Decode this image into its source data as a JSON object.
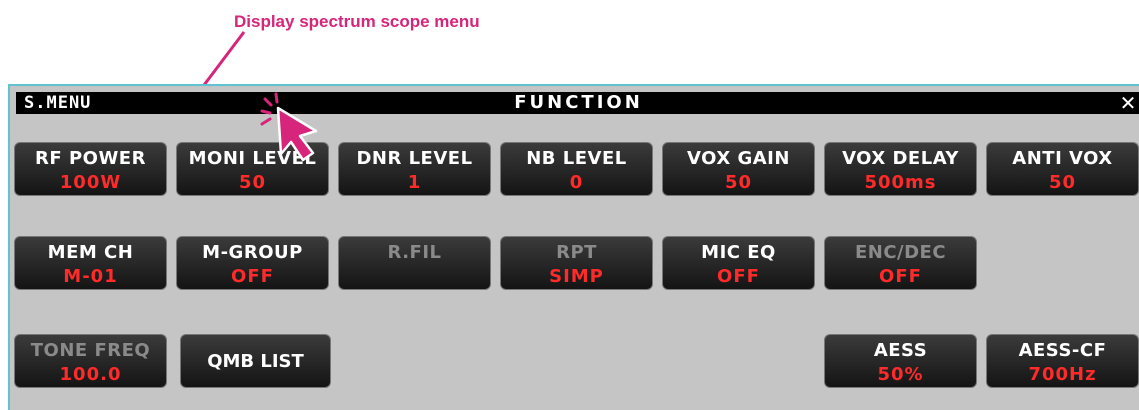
{
  "annotation": "Display spectrum scope menu",
  "titlebar": {
    "menu": "S.MENU",
    "title": "FUNCTION",
    "close": "✕"
  },
  "buttons": {
    "row1": [
      {
        "label": "RF POWER",
        "value": "100W"
      },
      {
        "label": "MONI LEVEL",
        "value": "50"
      },
      {
        "label": "DNR LEVEL",
        "value": "1"
      },
      {
        "label": "NB LEVEL",
        "value": "0"
      },
      {
        "label": "VOX GAIN",
        "value": "50"
      },
      {
        "label": "VOX DELAY",
        "value": "500ms"
      },
      {
        "label": "ANTI VOX",
        "value": "50"
      }
    ],
    "row2": [
      {
        "label": "MEM CH",
        "value": "M-01"
      },
      {
        "label": "M-GROUP",
        "value": "OFF"
      },
      {
        "label": "R.FIL"
      },
      {
        "label": "RPT",
        "value": "SIMP"
      },
      {
        "label": "MIC EQ",
        "value": "OFF"
      },
      {
        "label": "ENC/DEC",
        "value": "OFF"
      }
    ],
    "row3": [
      {
        "label": "TONE FREQ",
        "value": "100.0"
      },
      {
        "label": "QMB LIST"
      },
      {
        "label": "AESS",
        "value": "50%"
      },
      {
        "label": "AESS-CF",
        "value": "700Hz"
      }
    ]
  },
  "colors": {
    "annotation": "#d6257a",
    "value_text": "#ff2a2a",
    "panel_bg": "#c5c5c5",
    "title_bg": "#000000"
  },
  "icons": {
    "cursor": "pointer-arrow-icon",
    "close": "close-icon"
  }
}
